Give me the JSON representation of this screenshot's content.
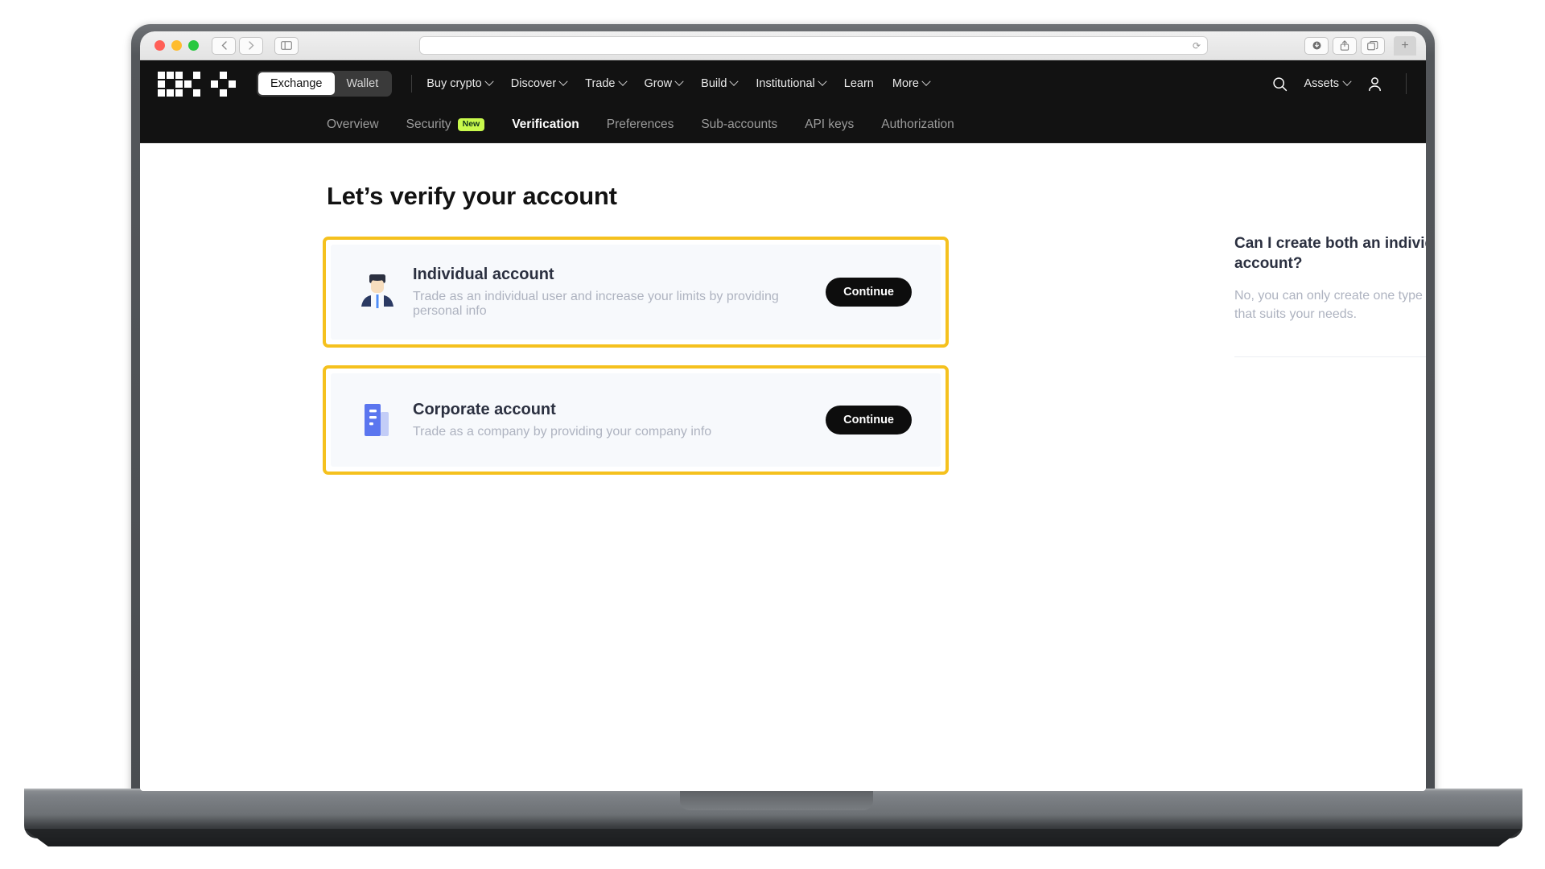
{
  "browser": {
    "back_icon": "chevron-left-icon",
    "forward_icon": "chevron-right-icon",
    "sidebar_icon": "sidebar-toggle-icon",
    "url_value": "",
    "url_placeholder": "",
    "reload_icon": "reload-icon",
    "downloads_icon": "downloads-icon",
    "share_icon": "share-icon",
    "tabs_icon": "tab-overview-icon",
    "new_tab_label": "+"
  },
  "topnav": {
    "logo_alt": "OKX",
    "segments": [
      {
        "label": "Exchange",
        "active": true
      },
      {
        "label": "Wallet",
        "active": false
      }
    ],
    "links": [
      {
        "label": "Buy crypto",
        "caret": true
      },
      {
        "label": "Discover",
        "caret": true
      },
      {
        "label": "Trade",
        "caret": true
      },
      {
        "label": "Grow",
        "caret": true
      },
      {
        "label": "Build",
        "caret": true
      },
      {
        "label": "Institutional",
        "caret": true
      },
      {
        "label": "Learn",
        "caret": false
      },
      {
        "label": "More",
        "caret": true
      }
    ],
    "search_icon": "search-icon",
    "assets_label": "Assets",
    "profile_icon": "user-avatar-icon"
  },
  "subnav": {
    "tabs": [
      {
        "label": "Overview",
        "active": false,
        "badge": ""
      },
      {
        "label": "Security",
        "active": false,
        "badge": "New"
      },
      {
        "label": "Verification",
        "active": true,
        "badge": ""
      },
      {
        "label": "Preferences",
        "active": false,
        "badge": ""
      },
      {
        "label": "Sub-accounts",
        "active": false,
        "badge": ""
      },
      {
        "label": "API keys",
        "active": false,
        "badge": ""
      },
      {
        "label": "Authorization",
        "active": false,
        "badge": ""
      }
    ]
  },
  "main": {
    "page_title": "Let’s verify your account",
    "cards": [
      {
        "icon": "individual-person-icon",
        "title": "Individual account",
        "description": "Trade as an individual user and increase your limits by providing personal info",
        "button_label": "Continue"
      },
      {
        "icon": "corporate-building-icon",
        "title": "Corporate account",
        "description": "Trade as a company by providing your company info",
        "button_label": "Continue"
      }
    ]
  },
  "faq": {
    "question": "Can I create both an individual and a corporate account?",
    "answer": "No, you can only create one type of account. Choose the option that suits your needs."
  },
  "colors": {
    "accent_yellow": "#F5C11E",
    "badge_green": "#C8F94C",
    "nav_background": "#121212",
    "card_background": "#F7F9FC",
    "button_black": "#0D0D0D"
  }
}
